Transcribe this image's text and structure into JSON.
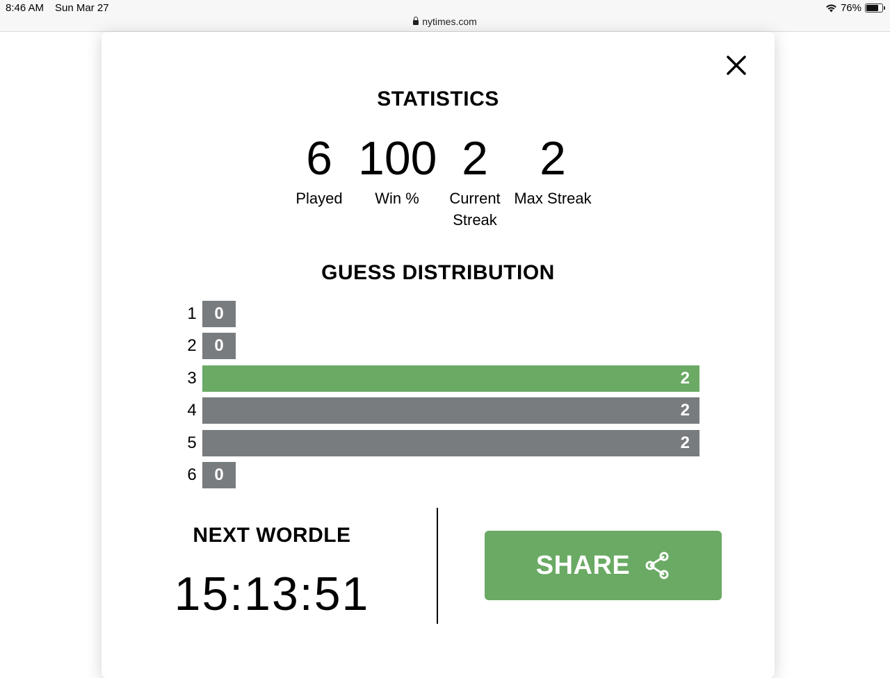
{
  "status_bar": {
    "time": "8:46 AM",
    "date": "Sun Mar 27",
    "url": "nytimes.com",
    "battery": "76%",
    "battery_level": 0.76
  },
  "modal": {
    "title": "STATISTICS",
    "stats": [
      {
        "value": "6",
        "label": "Played"
      },
      {
        "value": "100",
        "label": "Win %"
      },
      {
        "value": "2",
        "label": "Current Streak"
      },
      {
        "value": "2",
        "label": "Max Streak"
      }
    ],
    "distribution_title": "GUESS DISTRIBUTION",
    "distribution": [
      {
        "guess": "1",
        "count": "0",
        "fraction": 0
      },
      {
        "guess": "2",
        "count": "0",
        "fraction": 0
      },
      {
        "guess": "3",
        "count": "2",
        "fraction": 1,
        "highlight": true
      },
      {
        "guess": "4",
        "count": "2",
        "fraction": 1
      },
      {
        "guess": "5",
        "count": "2",
        "fraction": 1
      },
      {
        "guess": "6",
        "count": "0",
        "fraction": 0
      }
    ],
    "next_label": "NEXT WORDLE",
    "countdown": "15:13:51",
    "share_label": "SHARE"
  },
  "colors": {
    "correct_green": "#6aaa64",
    "bar_gray": "#787c7e"
  },
  "icons": [
    "lock-icon",
    "wifi-icon",
    "battery-icon",
    "close-icon",
    "share-icon"
  ]
}
